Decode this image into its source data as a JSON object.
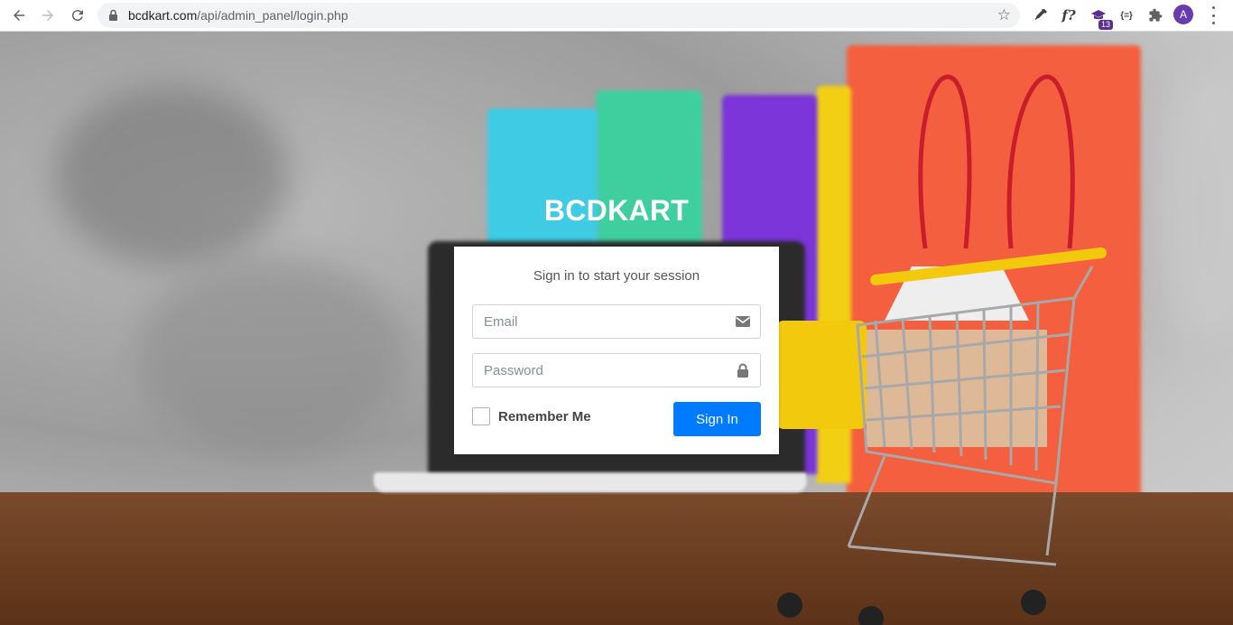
{
  "browser": {
    "url_host": "bcdkart.com",
    "url_path": "/api/admin_panel/login.php",
    "extension_badge": "13",
    "extension_json_label": "{=}",
    "extension_fx_label": "f?",
    "avatar_initial": "A"
  },
  "login": {
    "brand": "BCDKART",
    "message": "Sign in to start your session",
    "email_placeholder": "Email",
    "password_placeholder": "Password",
    "remember_label": "Remember Me",
    "signin_label": "Sign In"
  },
  "colors": {
    "primary_button": "#007bff",
    "avatar": "#6a3ab0",
    "extension_badge": "#5b2d90"
  },
  "icons": [
    "back-icon",
    "forward-icon",
    "reload-icon",
    "lock-icon",
    "star-icon",
    "eyedropper-icon",
    "extension-puzzle-icon",
    "envelope-icon",
    "padlock-icon",
    "menu-dots-icon"
  ]
}
